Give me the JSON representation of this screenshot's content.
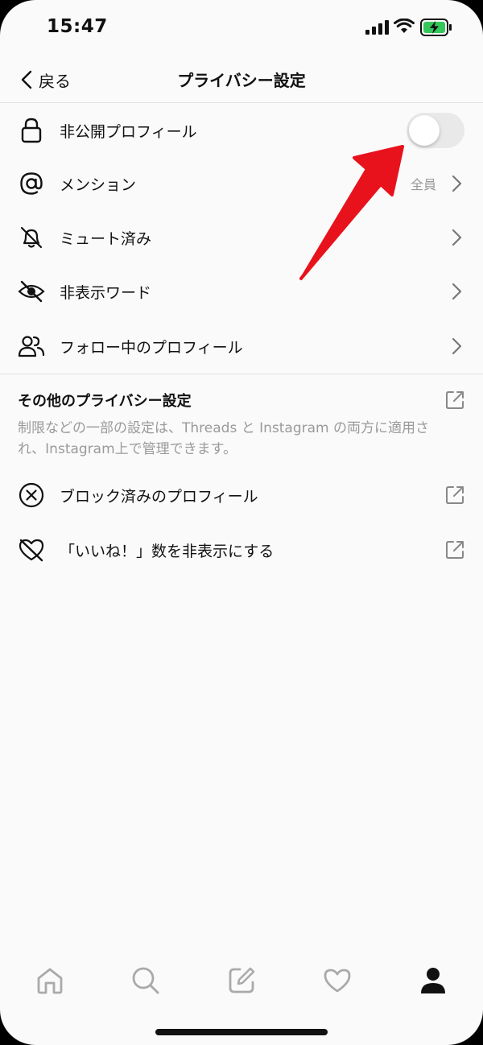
{
  "status_bar": {
    "time": "15:47"
  },
  "header": {
    "back_label": "戻る",
    "title": "プライバシー設定"
  },
  "settings": {
    "private_profile": {
      "label": "非公開プロフィール",
      "toggle_on": false
    },
    "mentions": {
      "label": "メンション",
      "value": "全員"
    },
    "muted": {
      "label": "ミュート済み"
    },
    "hidden_words": {
      "label": "非表示ワード"
    },
    "following_profiles": {
      "label": "フォロー中のプロフィール"
    }
  },
  "other_section": {
    "title": "その他のプライバシー設定",
    "description": "制限などの一部の設定は、Threads と Instagram の両方に適用され、Instagram上で管理できます。",
    "items": {
      "blocked": {
        "label": "ブロック済みのプロフィール"
      },
      "hide_likes": {
        "label": "「いいね！」数を非表示にする"
      }
    }
  },
  "tab_bar": {
    "tabs": [
      "home-icon",
      "search-icon",
      "compose-icon",
      "heart-icon",
      "profile-icon"
    ],
    "active": "profile-icon"
  },
  "colors": {
    "background": "#fafafa",
    "toggle_off": "#e9e9ea",
    "secondary_text": "#999999",
    "annotation_arrow": "#e8121c",
    "battery_fill": "#34c759"
  }
}
